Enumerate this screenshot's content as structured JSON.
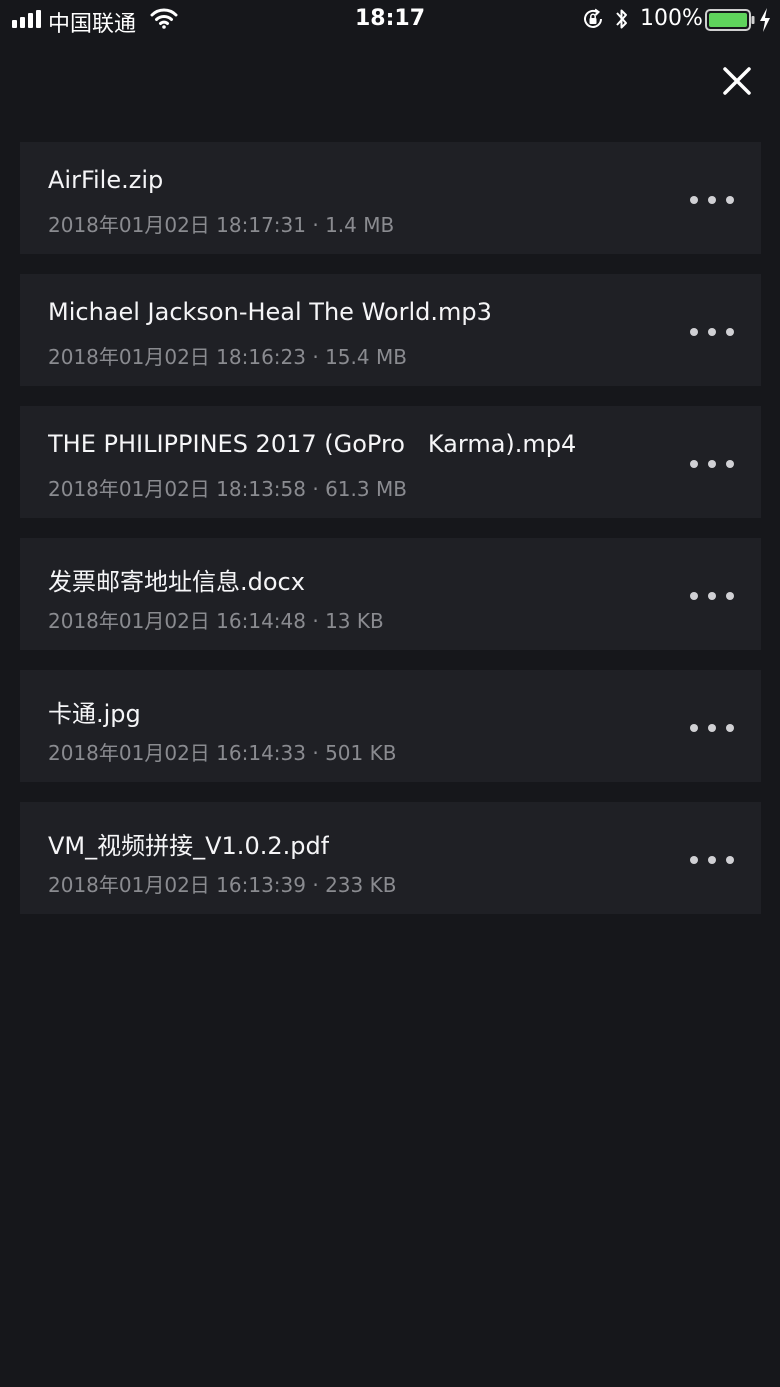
{
  "status_bar": {
    "carrier": "中国联通",
    "time": "18:17",
    "battery_percent": "100%",
    "battery_level": 1.0,
    "battery_color": "#5fd35c"
  },
  "icons": {
    "close": "close-icon",
    "more": "more-horizontal-icon"
  },
  "files": [
    {
      "name": "AirFile.zip",
      "date": "2018年01月02日 18:17:31",
      "size": "1.4 MB"
    },
    {
      "name": "Michael Jackson-Heal The World.mp3",
      "date": "2018年01月02日 18:16:23",
      "size": "15.4 MB"
    },
    {
      "name": "THE PHILIPPINES 2017 (GoPro   Karma).mp4",
      "date": "2018年01月02日 18:13:58",
      "size": "61.3 MB"
    },
    {
      "name": "发票邮寄地址信息.docx",
      "date": "2018年01月02日 16:14:48",
      "size": "13 KB"
    },
    {
      "name": "卡通.jpg",
      "date": "2018年01月02日 16:14:33",
      "size": "501 KB"
    },
    {
      "name": "VM_视频拼接_V1.0.2.pdf",
      "date": "2018年01月02日 16:13:39",
      "size": "233 KB"
    }
  ],
  "meta_separator": " · "
}
